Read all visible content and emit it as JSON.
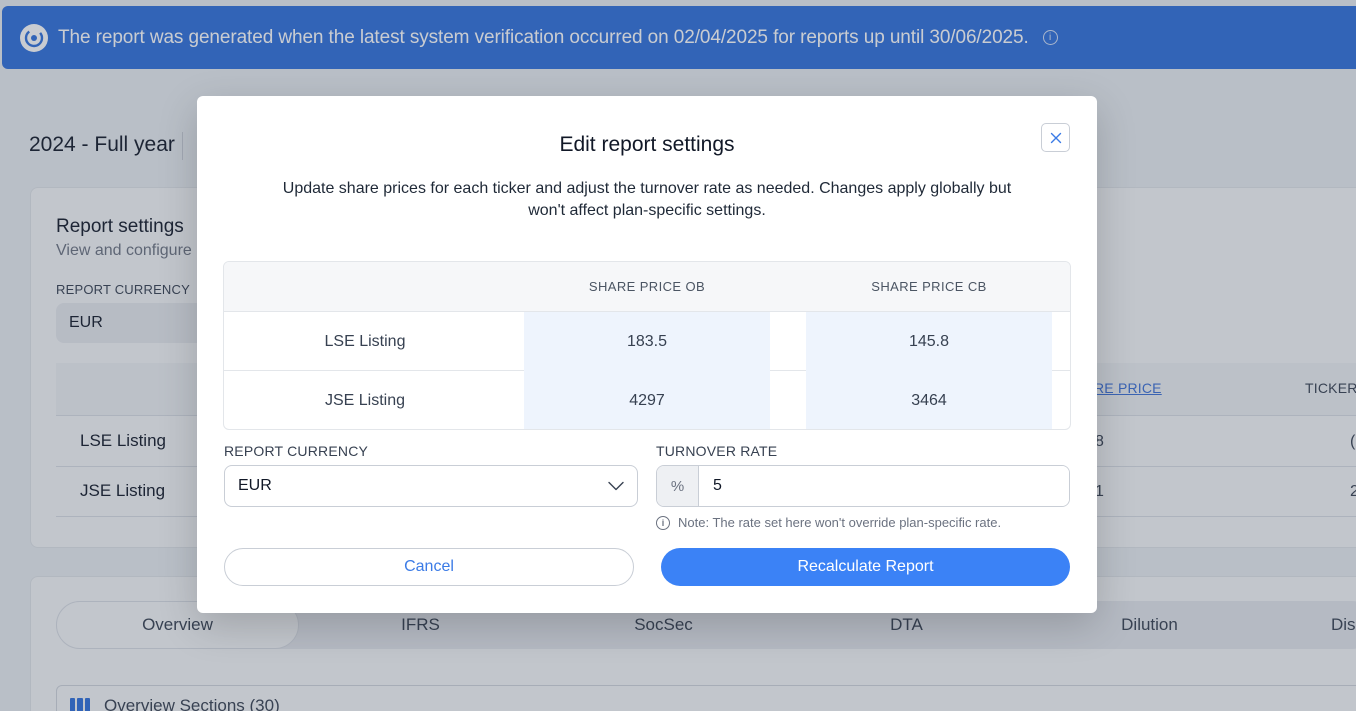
{
  "banner": {
    "text": "The report was generated when the latest system verification occurred on 02/04/2025 for reports up until 30/06/2025.",
    "info_glyph": "i"
  },
  "background": {
    "period_title": "2024 - Full year",
    "card_title": "Report settings",
    "card_subtitle": "View and configure",
    "currency_label": "REPORT CURRENCY",
    "currency_value": "EUR",
    "share_price_header": "RE PRICE",
    "ticker_header": "TICKER",
    "rows": [
      {
        "label": "LSE Listing",
        "frag1": "8",
        "frag2": "("
      },
      {
        "label": "JSE Listing",
        "frag1": "1",
        "frag2": "2"
      }
    ],
    "tabs": [
      "Overview",
      "IFRS",
      "SocSec",
      "DTA",
      "Dilution",
      "Disc"
    ],
    "sections_label": "Overview Sections (30)"
  },
  "modal": {
    "title": "Edit report settings",
    "description": "Update share prices for each ticker and adjust the turnover rate as needed. Changes apply globally but won't affect plan-specific settings.",
    "table": {
      "headers": [
        "",
        "SHARE PRICE OB",
        "SHARE PRICE CB"
      ],
      "rows": [
        {
          "ticker": "LSE Listing",
          "ob": "183.5",
          "cb": "145.8"
        },
        {
          "ticker": "JSE Listing",
          "ob": "4297",
          "cb": "3464"
        }
      ]
    },
    "currency": {
      "label": "REPORT CURRENCY",
      "value": "EUR"
    },
    "turnover": {
      "label": "TURNOVER RATE",
      "prefix": "%",
      "value": "5"
    },
    "note": "Note: The rate set here won't override plan-specific rate.",
    "note_glyph": "i",
    "cancel_label": "Cancel",
    "recalculate_label": "Recalculate Report"
  },
  "colors": {
    "banner": "#2f6fdc",
    "primary_button": "#3b82f6",
    "cell_highlight": "#eef4fd",
    "link": "#3b7be6"
  },
  "icons": [
    "banner-logo-icon",
    "info-icon",
    "close-icon",
    "chevron-down-icon",
    "sections-grid-icon"
  ]
}
